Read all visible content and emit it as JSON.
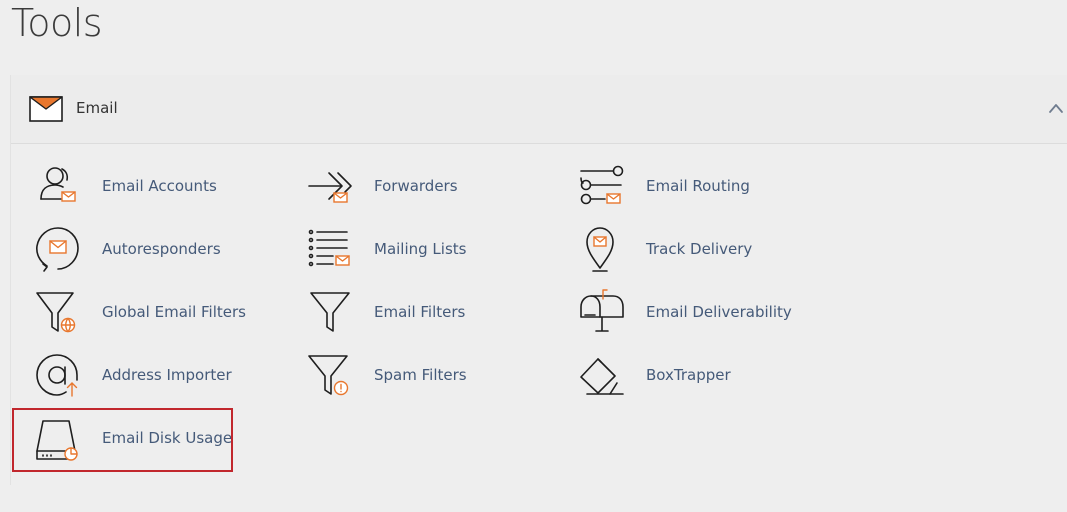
{
  "page": {
    "title": "Tools"
  },
  "email_section": {
    "title": "Email",
    "icon": "envelope-icon",
    "collapse_icon": "chevron-up-icon",
    "tools": [
      {
        "label": "Email Accounts",
        "icon": "user-mail-icon"
      },
      {
        "label": "Forwarders",
        "icon": "forward-arrow-icon"
      },
      {
        "label": "Email Routing",
        "icon": "routing-icon"
      },
      {
        "label": "Autoresponders",
        "icon": "autorespond-icon"
      },
      {
        "label": "Mailing Lists",
        "icon": "list-mail-icon"
      },
      {
        "label": "Track Delivery",
        "icon": "map-pin-mail-icon"
      },
      {
        "label": "Global Email Filters",
        "icon": "funnel-globe-icon"
      },
      {
        "label": "Email Filters",
        "icon": "funnel-icon"
      },
      {
        "label": "Email Deliverability",
        "icon": "mailbox-icon"
      },
      {
        "label": "Address Importer",
        "icon": "at-upload-icon"
      },
      {
        "label": "Spam Filters",
        "icon": "funnel-alert-icon"
      },
      {
        "label": "BoxTrapper",
        "icon": "box-trap-icon"
      },
      {
        "label": "Email Disk Usage",
        "icon": "disk-usage-icon"
      }
    ]
  },
  "colors": {
    "background": "#eeeeee",
    "link": "#455a79",
    "accent": "#e8772e",
    "highlight_border": "#c1272d"
  }
}
